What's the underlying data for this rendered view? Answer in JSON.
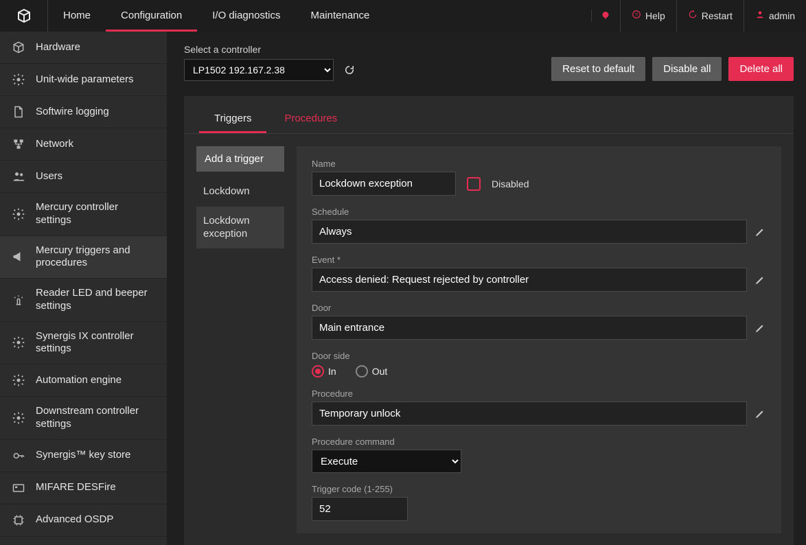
{
  "brand": "app-logo",
  "nav": {
    "tabs": [
      {
        "label": "Home",
        "active": false
      },
      {
        "label": "Configuration",
        "active": true
      },
      {
        "label": "I/O diagnostics",
        "active": false
      },
      {
        "label": "Maintenance",
        "active": false
      }
    ],
    "help": "Help",
    "restart": "Restart",
    "user": "admin"
  },
  "sidebar": {
    "items": [
      {
        "label": "Hardware",
        "icon": "cube-icon"
      },
      {
        "label": "Unit-wide parameters",
        "icon": "gear-icon"
      },
      {
        "label": "Softwire logging",
        "icon": "file-icon"
      },
      {
        "label": "Network",
        "icon": "network-icon"
      },
      {
        "label": "Users",
        "icon": "users-icon"
      },
      {
        "label": "Mercury controller settings",
        "icon": "gear-icon"
      },
      {
        "label": "Mercury triggers and procedures",
        "icon": "megaphone-icon",
        "active": true
      },
      {
        "label": "Reader LED and beeper settings",
        "icon": "alarm-icon"
      },
      {
        "label": "Synergis IX controller settings",
        "icon": "gear-icon"
      },
      {
        "label": "Automation engine",
        "icon": "gear-icon"
      },
      {
        "label": "Downstream controller settings",
        "icon": "gear-icon"
      },
      {
        "label": "Synergis™ key store",
        "icon": "key-icon"
      },
      {
        "label": "MIFARE DESFire",
        "icon": "card-icon"
      },
      {
        "label": "Advanced OSDP",
        "icon": "chip-icon"
      }
    ]
  },
  "controller": {
    "label": "Select a controller",
    "selected": "LP1502 192.167.2.38",
    "reset": "Reset to default",
    "disable_all": "Disable all",
    "delete_all": "Delete all"
  },
  "subtabs": {
    "triggers": "Triggers",
    "procedures": "Procedures"
  },
  "triggers": {
    "add": "Add a trigger",
    "items": [
      {
        "label": "Lockdown",
        "active": false
      },
      {
        "label": "Lockdown exception",
        "active": true
      }
    ]
  },
  "form": {
    "name_label": "Name",
    "name_value": "Lockdown exception",
    "disabled_label": "Disabled",
    "schedule_label": "Schedule",
    "schedule_value": "Always",
    "event_label": "Event *",
    "event_value": "Access denied: Request rejected by controller",
    "door_label": "Door",
    "door_value": "Main entrance",
    "door_side_label": "Door side",
    "door_side_in": "In",
    "door_side_out": "Out",
    "procedure_label": "Procedure",
    "procedure_value": "Temporary unlock",
    "proc_cmd_label": "Procedure command",
    "proc_cmd_value": "Execute",
    "trigger_code_label": "Trigger code (1-255)",
    "trigger_code_value": "52"
  }
}
